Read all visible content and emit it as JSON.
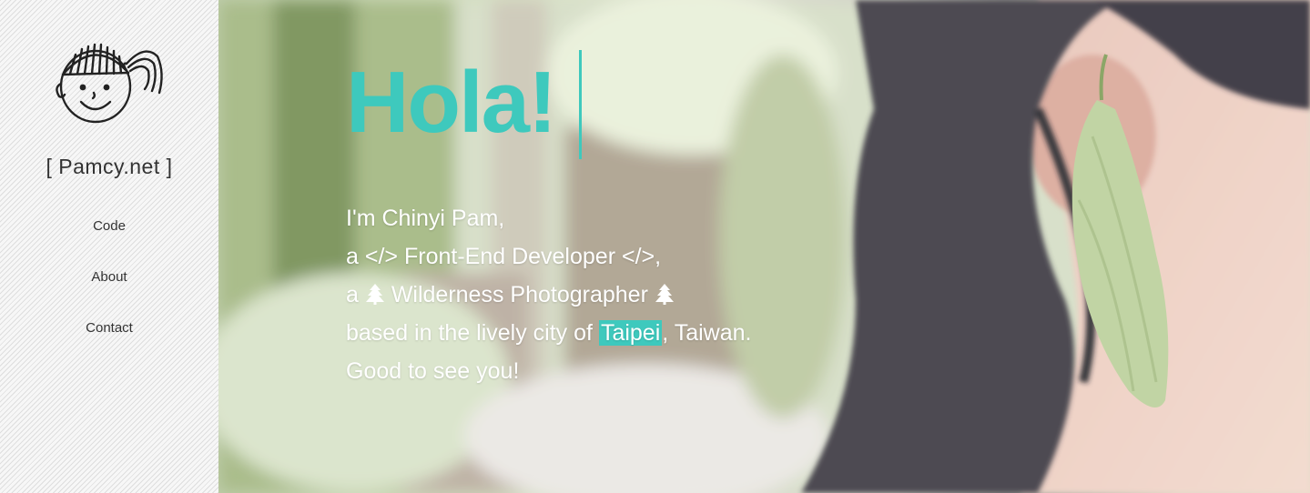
{
  "sidebar": {
    "site_name": "[ Pamcy.net ]",
    "nav": [
      {
        "label": "Code"
      },
      {
        "label": "About"
      },
      {
        "label": "Contact"
      }
    ]
  },
  "hero": {
    "headline": "Hola!",
    "intro": {
      "line1": "I'm Chinyi Pam,",
      "line2_prefix": "a",
      "line2_code_open": "</>",
      "line2_role": "Front-End Developer",
      "line2_code_close": "</>,",
      "line3_prefix": "a",
      "line3_role": "Wilderness Photographer",
      "line4_prefix": "based in the lively city of",
      "line4_city": "Taipei",
      "line4_suffix": ", Taiwan.",
      "line5": "Good to see you!"
    },
    "icons": {
      "tree": "tree-icon",
      "logo": "girl-face-icon"
    }
  },
  "colors": {
    "accent": "#3ec9bd",
    "sidebar_bg": "#f7f7f7",
    "text_dark": "#333333",
    "text_light": "#ffffff"
  }
}
